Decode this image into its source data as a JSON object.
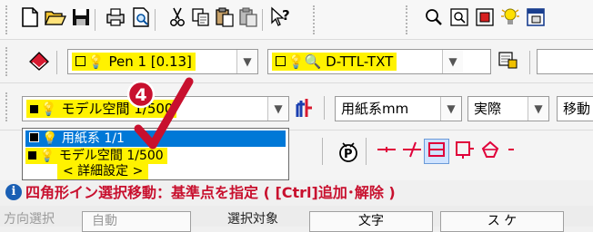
{
  "toolbar_standard": {
    "icons": [
      "new-file-icon",
      "open-folder-icon",
      "save-icon",
      "print-icon",
      "print-preview-icon",
      "cut-icon",
      "copy-icon",
      "paste-icon",
      "paste-special-icon",
      "context-help-icon",
      "zoom-icon",
      "zoom-window-icon",
      "zoom-extents-icon",
      "bulb-icon",
      "window-icon"
    ]
  },
  "layer_bar": {
    "pen_combo": "Pen 1 [0.13]",
    "layer_combo": "D-TTL-TXT"
  },
  "scale_bar": {
    "scale_combo": "モデル空間 1/500",
    "paper_unit_combo": "用紙系mm",
    "actual_combo": "実際",
    "move_label": "移動"
  },
  "scale_dropdown": {
    "options": [
      "用紙系 1/1",
      "モデル空間 1/500",
      "< 詳細設定 >"
    ],
    "selected_index": 0
  },
  "step_badge": "4",
  "status_message": "四角形イン選択移動：基準点を指定 ( [Ctrl]追加･解除 )",
  "bottom_row": {
    "label1": "方向選択",
    "label2": "自動",
    "label3": "選択対象",
    "button1": "文字",
    "button2": "ス ケ"
  },
  "colors": {
    "highlight_yellow": "#fff200",
    "selection_blue": "#0078d7",
    "badge_red": "#c8102e",
    "drafting_red": "#e0003a"
  }
}
